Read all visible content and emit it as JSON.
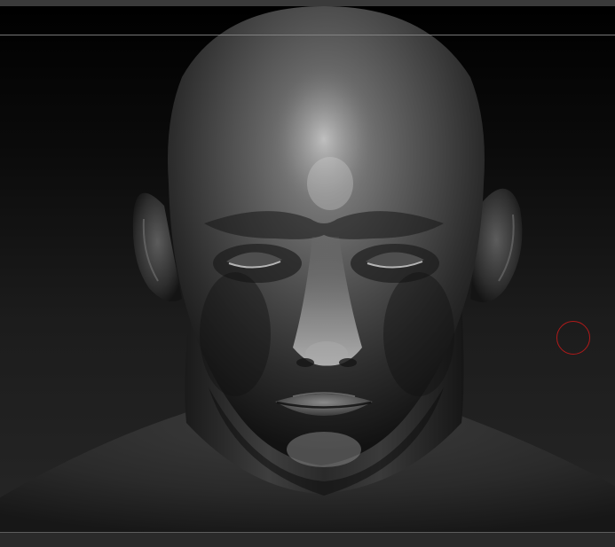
{
  "app": {
    "window_title": ""
  },
  "viewport": {
    "model": "head-bust-sculpt",
    "material": "matcap-gray",
    "background_top": "#000000",
    "background_bottom": "#262626"
  },
  "brush": {
    "cursor_color": "#b01a1a",
    "icon": "brush-cursor-icon"
  },
  "colors": {
    "frame": "#3a3a3a",
    "guide": "#8a8a8a"
  }
}
